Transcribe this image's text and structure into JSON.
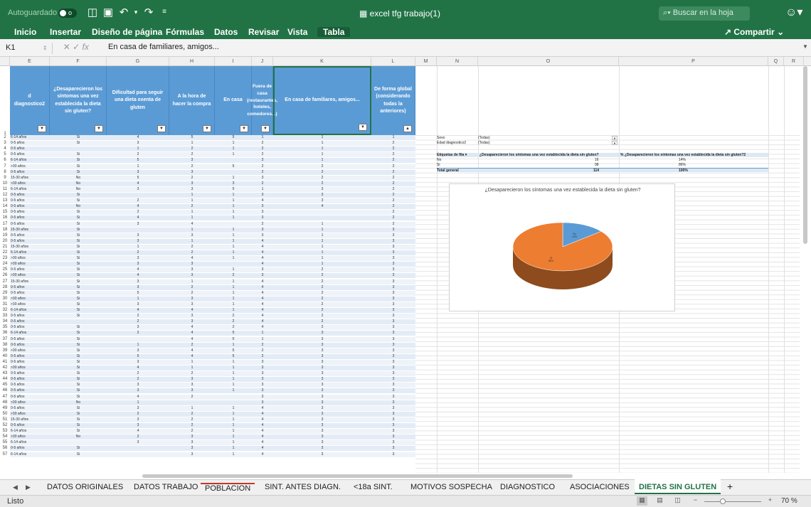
{
  "titlebar": {
    "autosave": "Autoguardado",
    "autosave_state": "o",
    "title": "excel tfg trabajo(1)",
    "search_placeholder": "Buscar en la hoja"
  },
  "ribbon": {
    "tabs": [
      "Inicio",
      "Insertar",
      "Diseño de página",
      "Fórmulas",
      "Datos",
      "Revisar",
      "Vista",
      "Tabla"
    ],
    "active_tab": "Tabla",
    "share": "Compartir"
  },
  "formula_bar": {
    "cell_ref": "K1",
    "fx": "fx",
    "content": "En casa de familiares, amigos..."
  },
  "columns": [
    "E",
    "F",
    "G",
    "H",
    "I",
    "J",
    "K",
    "L",
    "M",
    "N",
    "O",
    "P",
    "Q",
    "R"
  ],
  "headers": [
    {
      "col": "E",
      "text": "d diagnostico2"
    },
    {
      "col": "F",
      "text": "¿Desaparecieron los síntomas una vez establecida la dieta sin gluten?"
    },
    {
      "col": "G",
      "text": "Dificultad para seguir una dieta exenta de gluten"
    },
    {
      "col": "H",
      "text": "A la hora de hacer la compra"
    },
    {
      "col": "I",
      "text": "En casa"
    },
    {
      "col": "J",
      "text": "Fuera de casa (restaurantes, hoteles, comedores...)"
    },
    {
      "col": "K",
      "text": "En casa de familiares, amigos..."
    },
    {
      "col": "L",
      "text": "De forma global (considerando todas la anteriores)"
    }
  ],
  "rows": [
    [
      "6-14 años",
      "Si",
      "4",
      "5",
      "5",
      "1",
      "1",
      "1"
    ],
    [
      "0-5 años",
      "Si",
      "3",
      "1",
      "1",
      "2",
      "1",
      "2"
    ],
    [
      "0-5 años",
      "",
      "1",
      "2",
      "1",
      "2",
      "1",
      "2"
    ],
    [
      "0-5 años",
      "Si",
      "2",
      "2",
      "1",
      "2",
      "1",
      "2"
    ],
    [
      "6-14 años",
      "Si",
      "5",
      "3",
      "",
      "3",
      "1",
      "2"
    ],
    [
      ">30 años",
      "Si",
      "1",
      "2",
      "5",
      "2",
      "2",
      "2"
    ],
    [
      "0-5 años",
      "Si",
      "3",
      "3",
      "",
      "2",
      "2",
      "2"
    ],
    [
      "15-30 años",
      "No",
      "5",
      "2",
      "1",
      "3",
      "2",
      "2"
    ],
    [
      ">30 años",
      "No",
      "4",
      "3",
      "3",
      "2",
      "2",
      "2"
    ],
    [
      "6-14 años",
      "No",
      "3",
      "3",
      "5",
      "1",
      "3",
      "2"
    ],
    [
      "0-5 años",
      "Si",
      "",
      "1",
      "1",
      "3",
      "3",
      "2"
    ],
    [
      "0-5 años",
      "Si",
      "2",
      "1",
      "1",
      "4",
      "3",
      "2"
    ],
    [
      "0-5 años",
      "No",
      "4",
      "2",
      "1",
      "3",
      "4",
      "2"
    ],
    [
      "0-5 años",
      "Si",
      "2",
      "1",
      "1",
      "3",
      "",
      "2"
    ],
    [
      "0-5 años",
      "Si",
      "4",
      "1",
      "1",
      "3",
      "",
      "2"
    ],
    [
      "0-5 años",
      "Si",
      "3",
      "4",
      "",
      "2",
      "1",
      "2"
    ],
    [
      "15-30 años",
      "Si",
      "",
      "1",
      "1",
      "3",
      "1",
      "3"
    ],
    [
      "0-5 años",
      "Si",
      "3",
      "3",
      "1",
      "3",
      "1",
      "3"
    ],
    [
      "0-5 años",
      "Si",
      "3",
      "1",
      "1",
      "4",
      "1",
      "3"
    ],
    [
      "15-30 años",
      "Si",
      "1",
      "2",
      "1",
      "4",
      "1",
      "3"
    ],
    [
      "6-14 años",
      "Si",
      "2",
      "2",
      "1",
      "4",
      "1",
      "3"
    ],
    [
      ">30 años",
      "Si",
      "3",
      "4",
      "1",
      "4",
      "1",
      "3"
    ],
    [
      ">30 años",
      "Si",
      "3",
      "3",
      "",
      "4",
      "1",
      "3"
    ],
    [
      "0-5 años",
      "Si",
      "4",
      "3",
      "1",
      "3",
      "2",
      "3"
    ],
    [
      ">30 años",
      "Si",
      "4",
      "3",
      "2",
      "3",
      "2",
      "3"
    ],
    [
      "15-30 años",
      "Si",
      "3",
      "1",
      "1",
      "4",
      "2",
      "3"
    ],
    [
      "0-5 años",
      "Si",
      "3",
      "2",
      "1",
      "4",
      "2",
      "3"
    ],
    [
      "0-5 años",
      "Si",
      "5",
      "2",
      "1",
      "4",
      "2",
      "3"
    ],
    [
      ">30 años",
      "Si",
      "1",
      "3",
      "1",
      "4",
      "2",
      "3"
    ],
    [
      ">30 años",
      "Si",
      "3",
      "3",
      "1",
      "4",
      "2",
      "3"
    ],
    [
      "6-14 años",
      "Si",
      "4",
      "4",
      "1",
      "4",
      "2",
      "3"
    ],
    [
      "0-5 años",
      "Si",
      "2",
      "3",
      "2",
      "4",
      "2",
      "3"
    ],
    [
      "0-5 años",
      "",
      "2",
      "3",
      "2",
      "4",
      "2",
      "3"
    ],
    [
      "0-5 años",
      "Si",
      "3",
      "4",
      "2",
      "4",
      "2",
      "3"
    ],
    [
      "6-14 años",
      "Si",
      "2",
      "4",
      "5",
      "1",
      "3",
      "3"
    ],
    [
      "0-5 años",
      "Si",
      "",
      "4",
      "5",
      "1",
      "3",
      "3"
    ],
    [
      "0-5 años",
      "Si",
      "1",
      "2",
      "1",
      "2",
      "3",
      "3"
    ],
    [
      ">30 años",
      "Si",
      "3",
      "4",
      "5",
      "2",
      "3",
      "3"
    ],
    [
      "0-5 años",
      "Si",
      "5",
      "4",
      "5",
      "2",
      "3",
      "3"
    ],
    [
      "0-5 años",
      "Si",
      "3",
      "1",
      "1",
      "3",
      "3",
      "3"
    ],
    [
      ">30 años",
      "Si",
      "4",
      "1",
      "1",
      "3",
      "3",
      "3"
    ],
    [
      "0-5 años",
      "Si",
      "2",
      "2",
      "1",
      "3",
      "3",
      "3"
    ],
    [
      "0-5 años",
      "Si",
      "2",
      "3",
      "1",
      "3",
      "3",
      "3"
    ],
    [
      "0-5 años",
      "Si",
      "3",
      "3",
      "1",
      "3",
      "3",
      "3"
    ],
    [
      "0-5 años",
      "Si",
      "3",
      "3",
      "1",
      "3",
      "3",
      "3"
    ],
    [
      "0-5 años",
      "Si",
      "4",
      "2",
      "",
      "3",
      "3",
      "3"
    ],
    [
      ">30 años",
      "No",
      "1",
      "",
      "",
      "3",
      "3",
      "3"
    ],
    [
      "0-5 años",
      "Si",
      "3",
      "1",
      "1",
      "4",
      "3",
      "3"
    ],
    [
      ">30 años",
      "Si",
      "2",
      "2",
      "1",
      "4",
      "3",
      "3"
    ],
    [
      "15-30 años",
      "Si",
      "3",
      "2",
      "1",
      "4",
      "3",
      "3"
    ],
    [
      "0-5 años",
      "Si",
      "3",
      "2",
      "1",
      "4",
      "3",
      "3"
    ],
    [
      "6-14 años",
      "Si",
      "4",
      "2",
      "1",
      "4",
      "3",
      "3"
    ],
    [
      ">30 años",
      "No",
      "2",
      "3",
      "1",
      "4",
      "3",
      "3"
    ],
    [
      "6-14 años",
      "",
      "3",
      "3",
      "1",
      "4",
      "3",
      "3"
    ],
    [
      "0-5 años",
      "Si",
      "",
      "3",
      "1",
      "4",
      "3",
      "3"
    ],
    [
      "6-14 años",
      "Si",
      "",
      "3",
      "1",
      "4",
      "3",
      "3"
    ]
  ],
  "row_numbers_start": 2,
  "pivot": {
    "filters": [
      {
        "label": "Sexo",
        "value": "(Todas)"
      },
      {
        "label": "Edad diagnostico2",
        "value": "(Todas)"
      }
    ],
    "header": [
      "Etiquetas de fila",
      "¿Desaparecieron los síntomas una vez establecida la dieta sin gluten?",
      "% ¿Desaparecieron los síntomas una vez establecida la dieta sin gluten?2"
    ],
    "rows": [
      {
        "label": "No",
        "count": "16",
        "pct": "14%"
      },
      {
        "label": "Si",
        "count": "98",
        "pct": "86%"
      },
      {
        "label": "Total general",
        "count": "114",
        "pct": "100%"
      }
    ]
  },
  "chart_data": {
    "type": "pie",
    "title": "¿Desaparecieron los síntomas una vez establecida la dieta sin gluten?",
    "categories": [
      "No",
      "Si"
    ],
    "values": [
      16,
      98
    ],
    "labels": [
      "No\n14%",
      "Si\n86%"
    ],
    "colors": [
      "#5b9bd5",
      "#ed7d31"
    ]
  },
  "sheet_tabs": [
    "DATOS ORIGINALES",
    "DATOS TRABAJO",
    "POBLACION",
    "SINT. ANTES DIAGN.",
    "<18a SINT.",
    "MOTIVOS SOSPECHA",
    "DIAGNOSTICO",
    "ASOCIACIONES",
    "DIETAS SIN GLUTEN",
    "+"
  ],
  "active_sheet": "DIETAS SIN GLUTEN",
  "status": "Listo",
  "zoom": "70 %",
  "colors": {
    "excel_green": "#217346",
    "header_blue": "#5b9bd5",
    "pie_blue": "#5b9bd5",
    "pie_orange": "#ed7d31"
  }
}
